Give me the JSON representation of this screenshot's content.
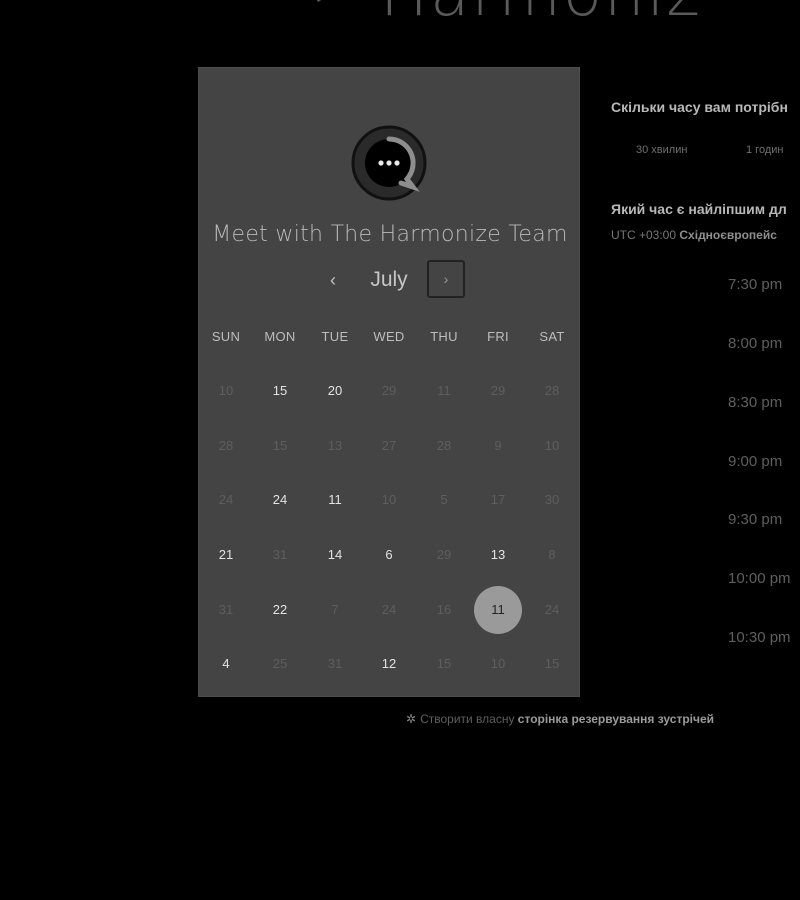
{
  "brand": {
    "wordmark": "Harmoniz",
    "icon": "harmonize-logo-icon"
  },
  "booking": {
    "title": "Meet with The Harmonize Team",
    "logo_icon": "chat-bubble-icon",
    "month": "July",
    "prev": "‹",
    "next": "›",
    "weekdays": [
      "SUN",
      "MON",
      "TUE",
      "WED",
      "THU",
      "FRI",
      "SAT"
    ],
    "weeks": [
      [
        {
          "d": "10",
          "e": false
        },
        {
          "d": "15",
          "e": true
        },
        {
          "d": "20",
          "e": true
        },
        {
          "d": "29",
          "e": false
        },
        {
          "d": "11",
          "e": false
        },
        {
          "d": "29",
          "e": false
        },
        {
          "d": "28",
          "e": false
        }
      ],
      [
        {
          "d": "28",
          "e": false
        },
        {
          "d": "15",
          "e": false
        },
        {
          "d": "13",
          "e": false
        },
        {
          "d": "27",
          "e": false
        },
        {
          "d": "28",
          "e": false
        },
        {
          "d": "9",
          "e": false
        },
        {
          "d": "10",
          "e": false
        }
      ],
      [
        {
          "d": "24",
          "e": false
        },
        {
          "d": "24",
          "e": true
        },
        {
          "d": "11",
          "e": true
        },
        {
          "d": "10",
          "e": false
        },
        {
          "d": "5",
          "e": false
        },
        {
          "d": "17",
          "e": false
        },
        {
          "d": "30",
          "e": false
        }
      ],
      [
        {
          "d": "21",
          "e": true
        },
        {
          "d": "31",
          "e": false
        },
        {
          "d": "14",
          "e": true
        },
        {
          "d": "6",
          "e": true
        },
        {
          "d": "29",
          "e": false
        },
        {
          "d": "13",
          "e": true
        },
        {
          "d": "8",
          "e": false
        }
      ],
      [
        {
          "d": "31",
          "e": false
        },
        {
          "d": "22",
          "e": true
        },
        {
          "d": "7",
          "e": false
        },
        {
          "d": "24",
          "e": false
        },
        {
          "d": "16",
          "e": false
        },
        {
          "d": "11",
          "e": true,
          "selected": true
        },
        {
          "d": "24",
          "e": false
        }
      ],
      [
        {
          "d": "4",
          "e": true
        },
        {
          "d": "25",
          "e": false
        },
        {
          "d": "31",
          "e": false
        },
        {
          "d": "12",
          "e": true
        },
        {
          "d": "15",
          "e": false
        },
        {
          "d": "10",
          "e": false
        },
        {
          "d": "15",
          "e": false
        }
      ]
    ]
  },
  "duration": {
    "question": "Скільки часу вам потрібн",
    "options": [
      "30 хвилин",
      "1 годин"
    ]
  },
  "timepick": {
    "question": "Який час є найліпшим дл",
    "tz_offset": "UTC +03:00",
    "tz_name": "Східноєвропейс",
    "slots": [
      "7:30 pm",
      "8:00 pm",
      "8:30 pm",
      "9:00 pm",
      "9:30 pm",
      "10:00 pm",
      "10:30 pm"
    ]
  },
  "footer": {
    "icon": "hubspot-sprocket-icon",
    "text": "Створити власну",
    "link": "сторінка резервування зустрічей"
  }
}
